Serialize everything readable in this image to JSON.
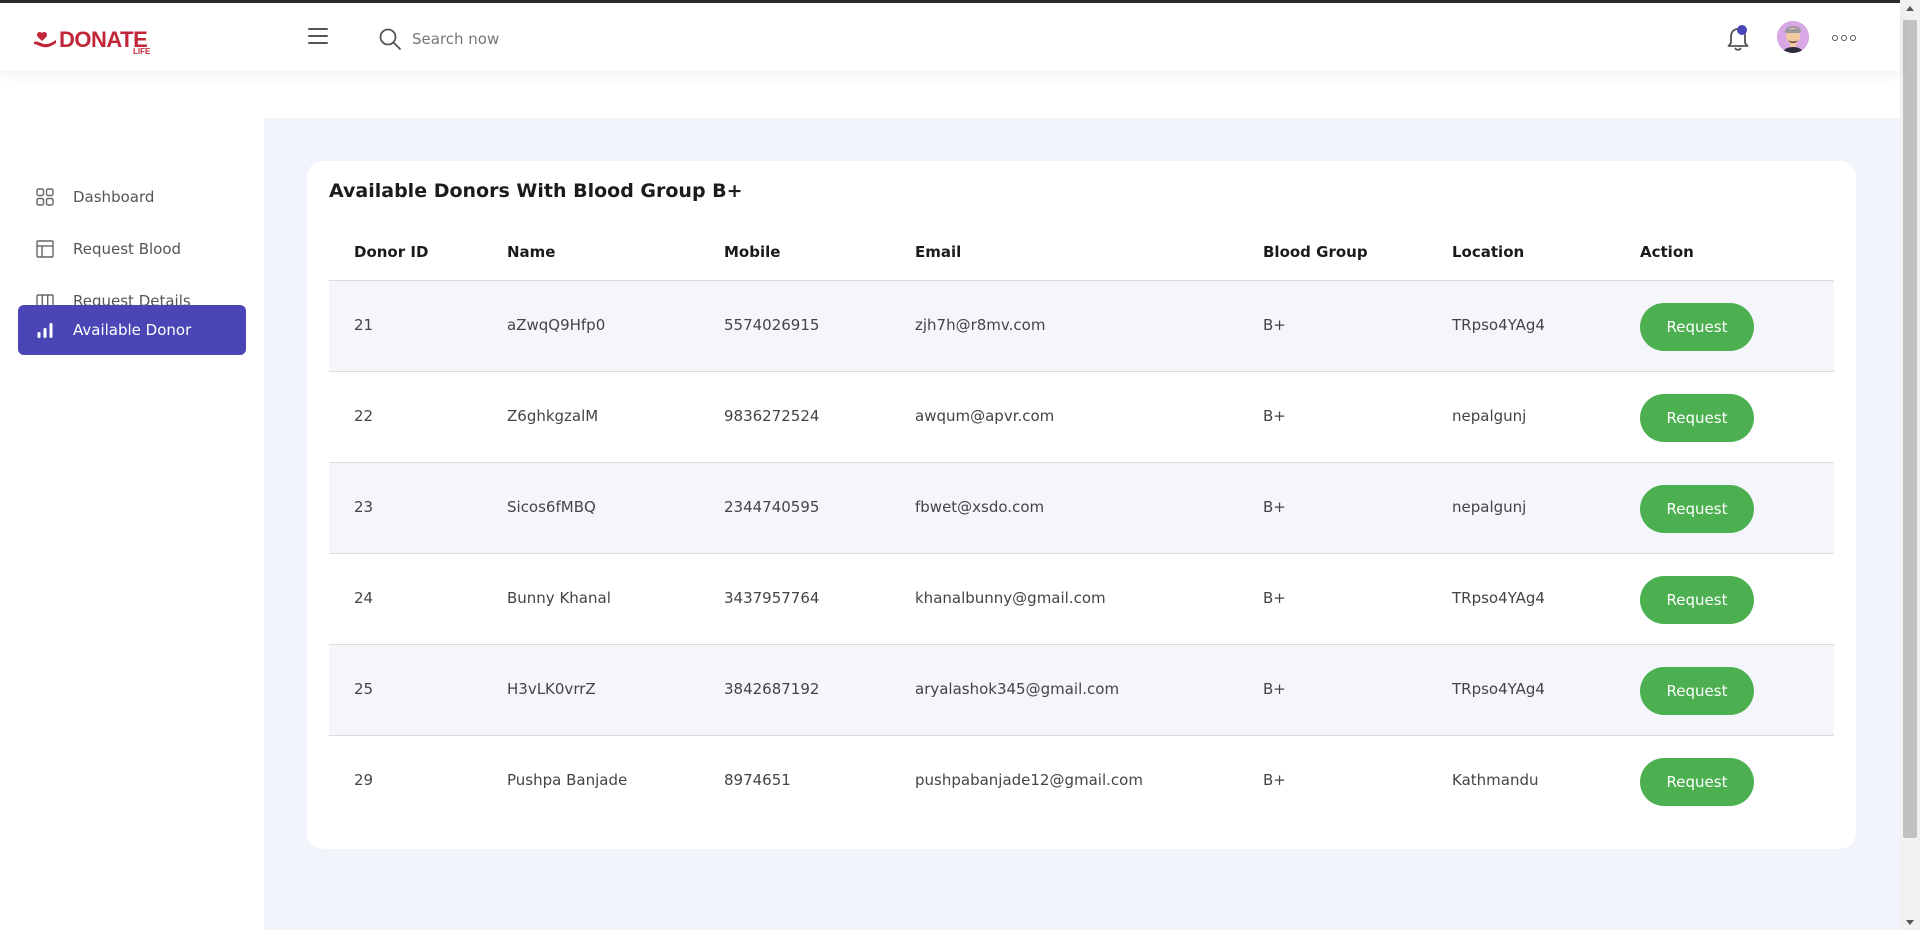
{
  "header": {
    "logo_text": "DONATE",
    "logo_sub": "LIFE",
    "search_placeholder": "Search now"
  },
  "sidebar": {
    "items": [
      {
        "label": "Dashboard",
        "icon": "grid-icon",
        "active": false
      },
      {
        "label": "Request Blood",
        "icon": "layout-icon",
        "active": false
      },
      {
        "label": "Request Details",
        "icon": "columns-icon",
        "active": false
      },
      {
        "label": "Available Donor",
        "icon": "bar-chart-icon",
        "active": true
      }
    ]
  },
  "main": {
    "title": "Available Donors With Blood Group B+",
    "columns": [
      "Donor ID",
      "Name",
      "Mobile",
      "Email",
      "Blood Group",
      "Location",
      "Action"
    ],
    "rows": [
      {
        "id": "21",
        "name": "aZwqQ9Hfp0",
        "mobile": "5574026915",
        "email": "zjh7h@r8mv.com",
        "blood_group": "B+",
        "location": "TRpso4YAg4",
        "action": "Request"
      },
      {
        "id": "22",
        "name": "Z6ghkgzalM",
        "mobile": "9836272524",
        "email": "awqum@apvr.com",
        "blood_group": "B+",
        "location": "nepalgunj",
        "action": "Request"
      },
      {
        "id": "23",
        "name": "Sicos6fMBQ",
        "mobile": "2344740595",
        "email": "fbwet@xsdo.com",
        "blood_group": "B+",
        "location": "nepalgunj",
        "action": "Request"
      },
      {
        "id": "24",
        "name": "Bunny Khanal",
        "mobile": "3437957764",
        "email": "khanalbunny@gmail.com",
        "blood_group": "B+",
        "location": "TRpso4YAg4",
        "action": "Request"
      },
      {
        "id": "25",
        "name": "H3vLK0vrrZ",
        "mobile": "3842687192",
        "email": "aryalashok345@gmail.com",
        "blood_group": "B+",
        "location": "TRpso4YAg4",
        "action": "Request"
      },
      {
        "id": "29",
        "name": "Pushpa Banjade",
        "mobile": "8974651",
        "email": "pushpabanjade12@gmail.com",
        "blood_group": "B+",
        "location": "Kathmandu",
        "action": "Request"
      }
    ]
  },
  "colors": {
    "brand": "#c0273a",
    "accent": "#4b46b6",
    "button": "#4caf50",
    "main_bg": "#f1f4fb"
  }
}
